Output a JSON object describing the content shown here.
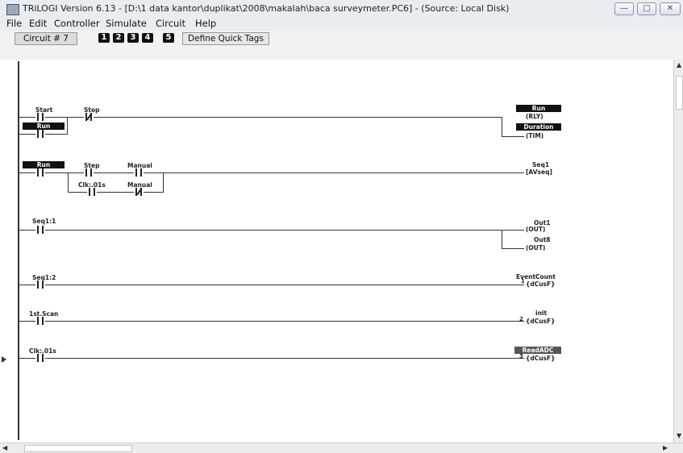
{
  "window": {
    "title": "TRiLOGI Version 6.13 - [D:\\1 data kantor\\duplikat\\2008\\makalah\\baca surveymeter.PC6] - (Source: Local Disk)"
  },
  "menu": [
    "File",
    "Edit",
    "Controller",
    "Simulate",
    "Circuit",
    "Help"
  ],
  "toolbar": {
    "circuit_label": "Circuit # 7",
    "numbers": [
      "1",
      "2",
      "3",
      "4",
      "5"
    ],
    "define_label": "Define Quick Tags"
  },
  "icons": {
    "minimize": "minimize-icon",
    "maximize": "maximize-icon",
    "close": "close-icon"
  },
  "rungs": [
    {
      "labels": {
        "start": "Start",
        "stop": "Stop",
        "run_branch": "Run"
      },
      "coils": [
        {
          "name": "Run",
          "type": "(RLY)"
        },
        {
          "name": "Duration",
          "type": "(TIM)"
        }
      ]
    },
    {
      "labels": {
        "run": "Run",
        "step": "Step",
        "manual": "Manual",
        "clk": "Clk:.01s",
        "manual2": "Manual"
      },
      "coils": [
        {
          "name": "Seq1",
          "type": "[AVseq]"
        }
      ]
    },
    {
      "labels": {
        "seq11": "Seq1:1"
      },
      "coils": [
        {
          "name": "Out1",
          "type": "(OUT)"
        },
        {
          "name": "Out8",
          "type": "(OUT)"
        }
      ]
    },
    {
      "labels": {
        "seq12": "Seq1:2"
      },
      "coils": [
        {
          "name": "EventCount",
          "type": "{dCusF}",
          "num": "1"
        }
      ]
    },
    {
      "labels": {
        "scan": "1st.Scan"
      },
      "coils": [
        {
          "name": "init",
          "type": "{dCusF}",
          "num": "2"
        }
      ]
    },
    {
      "labels": {
        "clk": "Clk:.01s"
      },
      "coils": [
        {
          "name": "ReadADC",
          "type": "{dCusF}",
          "num": "3"
        }
      ]
    }
  ]
}
